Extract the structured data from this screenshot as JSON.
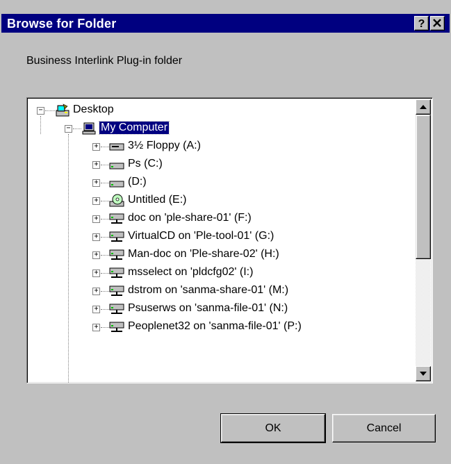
{
  "window": {
    "title": "Browse for Folder",
    "help_glyph": "?",
    "close_glyph": "✕"
  },
  "description": "Business Interlink Plug-in folder",
  "tree": {
    "desktop": {
      "label": "Desktop",
      "icon": "desktop-icon",
      "expander": "−"
    },
    "computer": {
      "label": "My Computer",
      "icon": "computer-icon",
      "expander": "−",
      "selected": true
    },
    "drives": [
      {
        "label": "3½ Floppy (A:)",
        "icon": "floppy-drive-icon"
      },
      {
        "label": "Ps (C:)",
        "icon": "hard-drive-icon"
      },
      {
        "label": " (D:)",
        "icon": "hard-drive-icon"
      },
      {
        "label": "Untitled (E:)",
        "icon": "cd-drive-icon"
      },
      {
        "label": "doc on 'ple-share-01' (F:)",
        "icon": "network-drive-icon"
      },
      {
        "label": "VirtualCD on 'Ple-tool-01' (G:)",
        "icon": "network-drive-icon"
      },
      {
        "label": "Man-doc on 'Ple-share-02' (H:)",
        "icon": "network-drive-icon"
      },
      {
        "label": "msselect on 'pldcfg02' (I:)",
        "icon": "network-drive-icon"
      },
      {
        "label": "dstrom on 'sanma-share-01' (M:)",
        "icon": "network-drive-icon"
      },
      {
        "label": "Psuserws on 'sanma-file-01' (N:)",
        "icon": "network-drive-icon"
      },
      {
        "label": "Peoplenet32 on 'sanma-file-01' (P:)",
        "icon": "network-drive-icon"
      }
    ],
    "expander_plus": "+"
  },
  "buttons": {
    "ok": "OK",
    "cancel": "Cancel"
  },
  "colors": {
    "titlebar": "#000080",
    "face": "#c0c0c0",
    "selection": "#000080"
  }
}
